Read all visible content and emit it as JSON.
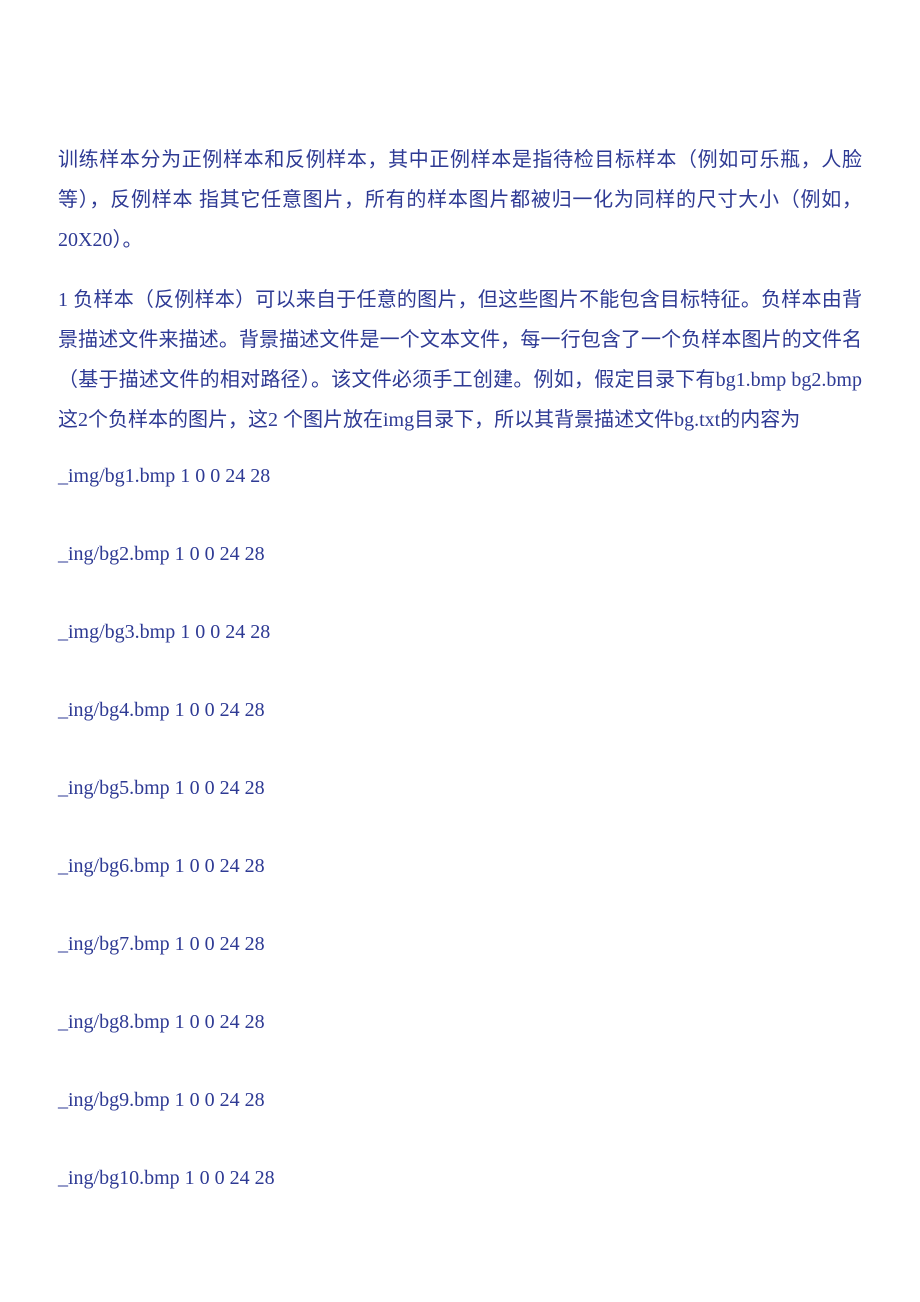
{
  "paragraphs": {
    "p1": "训练样本分为正例样本和反例样本，其中正例样本是指待检目标样本（例如可乐瓶，人脸等），反例样本 指其它任意图片，所有的样本图片都被归一化为同样的尺寸大小（例如，20X20）。",
    "p2": "1 负样本（反例样本）可以来自于任意的图片，但这些图片不能包含目标特征。负样本由背景描述文件来描述。背景描述文件是一个文本文件，每一行包含了一个负样本图片的文件名（基于描述文件的相对路径）。该文件必须手工创建。例如，假定目录下有bg1.bmp bg2.bmp这2个负样本的图片，这2 个图片放在img目录下，所以其背景描述文件bg.txt的内容为"
  },
  "lines": {
    "l1": "_img/bg1.bmp 1 0 0 24 28",
    "l2": "_ing/bg2.bmp 1 0 0 24 28",
    "l3": "_img/bg3.bmp 1 0 0 24 28",
    "l4": "_ing/bg4.bmp 1 0 0 24 28",
    "l5": "_ing/bg5.bmp 1 0 0 24 28",
    "l6": "_ing/bg6.bmp 1 0 0 24 28",
    "l7": "_ing/bg7.bmp 1 0 0 24 28",
    "l8": "_ing/bg8.bmp 1 0 0 24 28",
    "l9": "_ing/bg9.bmp 1 0 0 24 28",
    "l10": "_ing/bg10.bmp 1 0 0 24 28"
  }
}
